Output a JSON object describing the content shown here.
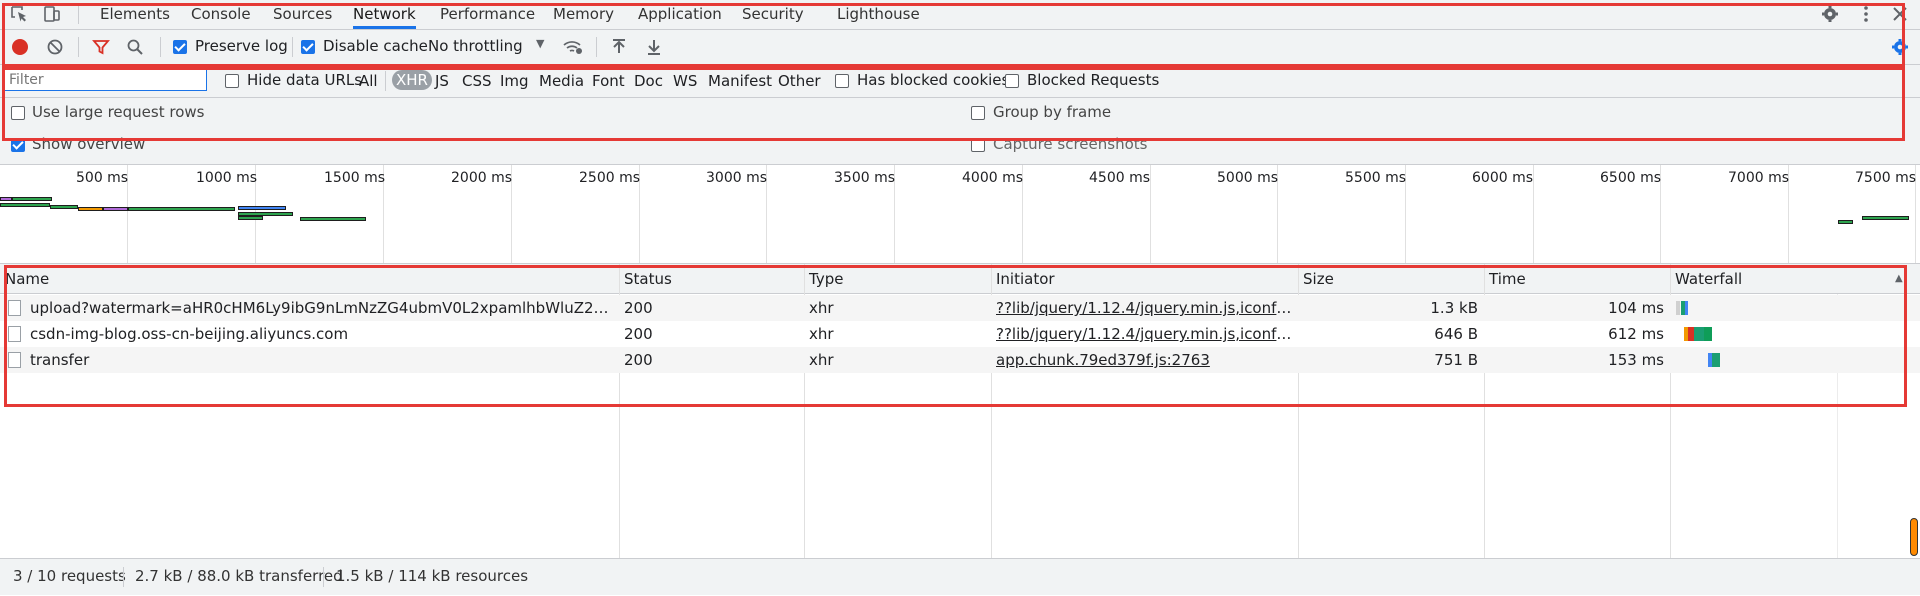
{
  "tabs": {
    "items": [
      {
        "label": "Elements"
      },
      {
        "label": "Console"
      },
      {
        "label": "Sources"
      },
      {
        "label": "Network"
      },
      {
        "label": "Performance"
      },
      {
        "label": "Memory"
      },
      {
        "label": "Application"
      },
      {
        "label": "Security"
      },
      {
        "label": "Lighthouse"
      }
    ],
    "active": "Network"
  },
  "toolbar": {
    "preserve_log": {
      "label": "Preserve log",
      "checked": true
    },
    "disable_cache": {
      "label": "Disable cache",
      "checked": true
    },
    "throttling": "No throttling"
  },
  "filter": {
    "placeholder": "Filter",
    "hide_data_urls": {
      "label": "Hide data URLs",
      "checked": false
    },
    "types": [
      "All",
      "XHR",
      "JS",
      "CSS",
      "Img",
      "Media",
      "Font",
      "Doc",
      "WS",
      "Manifest",
      "Other"
    ],
    "active_type": "XHR",
    "has_blocked_cookies": {
      "label": "Has blocked cookies",
      "checked": false
    },
    "blocked_requests": {
      "label": "Blocked Requests",
      "checked": false
    }
  },
  "settings": {
    "large_rows": {
      "label": "Use large request rows",
      "checked": false
    },
    "group_by_frame": {
      "label": "Group by frame",
      "checked": false
    },
    "show_overview": {
      "label": "Show overview",
      "checked": true
    },
    "capture_screenshots": {
      "label": "Capture screenshots",
      "checked": false
    }
  },
  "overview": {
    "ticks": [
      "500 ms",
      "1000 ms",
      "1500 ms",
      "2000 ms",
      "2500 ms",
      "3000 ms",
      "3500 ms",
      "4000 ms",
      "4500 ms",
      "5000 ms",
      "5500 ms",
      "6000 ms",
      "6500 ms",
      "7000 ms",
      "7500 ms"
    ]
  },
  "table": {
    "columns": [
      "Name",
      "Status",
      "Type",
      "Initiator",
      "Size",
      "Time",
      "Waterfall"
    ],
    "rows": [
      {
        "name": "upload?watermark=aHR0cHM6Ly9ibG9nLmNzZG4ubmV0L2xpamlhbWluZ2NjYw%3D...",
        "status": "200",
        "type": "xhr",
        "initiator": "??lib/jquery/1.12.4/jquery.min.js,iconfont/1....",
        "size": "1.3 kB",
        "time": "104 ms"
      },
      {
        "name": "csdn-img-blog.oss-cn-beijing.aliyuncs.com",
        "status": "200",
        "type": "xhr",
        "initiator": "??lib/jquery/1.12.4/jquery.min.js,iconfont/1....",
        "size": "646 B",
        "time": "612 ms"
      },
      {
        "name": "transfer",
        "status": "200",
        "type": "xhr",
        "initiator": "app.chunk.79ed379f.js:2763",
        "size": "751 B",
        "time": "153 ms"
      }
    ]
  },
  "status": {
    "requests": "3 / 10 requests",
    "transferred": "2.7 kB / 88.0 kB transferred",
    "resources": "1.5 kB / 114 kB resources"
  },
  "colors": {
    "accent": "#1a73e8",
    "record": "#d93025",
    "highlight": "#e53935"
  }
}
